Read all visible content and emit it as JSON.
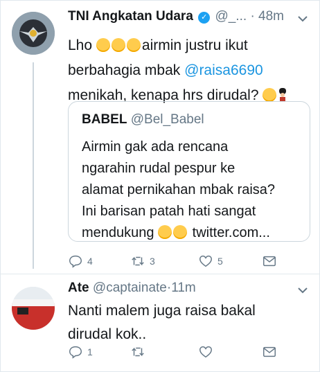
{
  "tweet1": {
    "name": "TNI Angkatan Udara",
    "handle": "@_...",
    "time": "48m",
    "text_line1": "Lho",
    "text_line1b": "airmin justru ikut",
    "text_line2a": "berbahagia mbak ",
    "mention": "@raisa6690",
    "text_line3": "menikah, kenapa hrs dirudal?",
    "quote": {
      "name": "BABEL",
      "handle": "@Bel_Babel",
      "line1": "Airmin gak ada rencana",
      "line2": "ngarahin rudal pespur ke",
      "line3": "alamat pernikahan mbak raisa?",
      "line4": "Ini barisan patah hati sangat",
      "line5a": "mendukung",
      "line5b": "twitter.com..."
    },
    "actions": {
      "reply_count": "4",
      "retweet_count": "3",
      "like_count": "5"
    }
  },
  "tweet2": {
    "name": "Ate",
    "handle": "@captainate",
    "time": "11m",
    "line1": "Nanti malem juga raisa bakal",
    "line2": "dirudal kok..",
    "actions": {
      "reply_count": "1",
      "retweet_count": "",
      "like_count": ""
    }
  },
  "colors": {
    "accent": "#1b95e0",
    "muted": "#657786",
    "verified": "#1da1f2"
  },
  "icons": [
    "verified-icon",
    "chevron-down-icon",
    "reply-icon",
    "retweet-icon",
    "like-icon",
    "dm-icon",
    "flushed-emoji",
    "laugh-cry-emoji",
    "guard-emoji",
    "sob-emoji"
  ]
}
